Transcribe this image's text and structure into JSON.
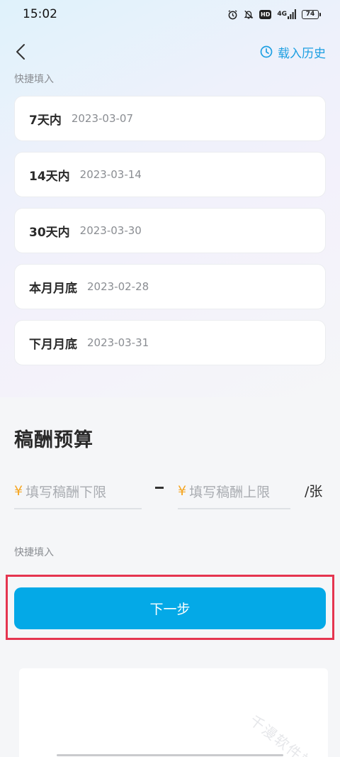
{
  "status_bar": {
    "time": "15:02",
    "network": "4G",
    "hd": "HD",
    "battery": "74",
    "icons": [
      "alarm-icon",
      "bell-mute-icon",
      "hd-icon",
      "signal-icon",
      "battery-icon"
    ]
  },
  "header": {
    "back_icon": "chevron-left-icon",
    "history_icon": "clock-icon",
    "history_label": "载入历史"
  },
  "deadline": {
    "hint": "快捷填入",
    "options": [
      {
        "label": "7天内",
        "date": "2023-03-07"
      },
      {
        "label": "14天内",
        "date": "2023-03-14"
      },
      {
        "label": "30天内",
        "date": "2023-03-30"
      },
      {
        "label": "本月月底",
        "date": "2023-02-28"
      },
      {
        "label": "下月月底",
        "date": "2023-03-31"
      }
    ]
  },
  "budget": {
    "title": "稿酬预算",
    "currency_symbol": "¥",
    "min_placeholder": "填写稿酬下限",
    "max_placeholder": "填写稿酬上限",
    "unit": "/张",
    "hint": "快捷填入"
  },
  "next_button": {
    "label": "下一步"
  },
  "watermark": "千漫软件站",
  "colors": {
    "accent": "#04a9e7",
    "link": "#1d9fe2",
    "currency": "#f5a623",
    "highlight": "#e53550"
  }
}
